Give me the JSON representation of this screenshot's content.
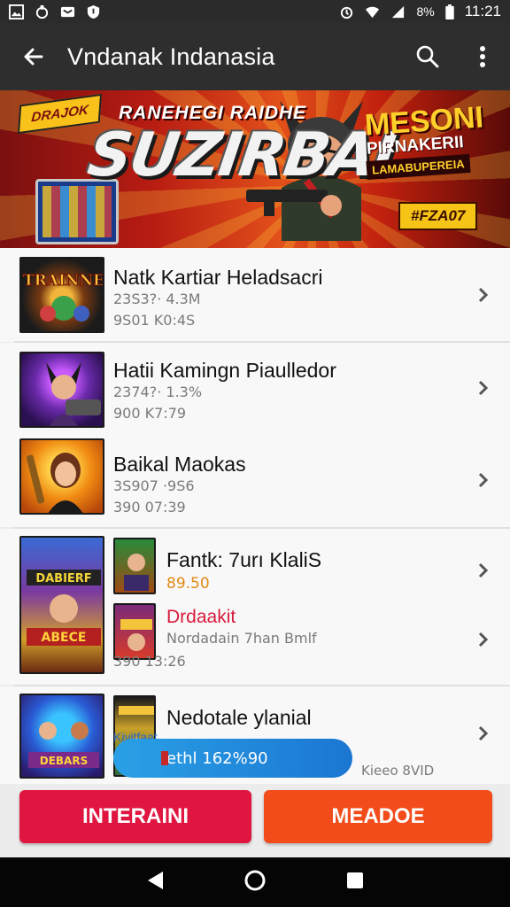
{
  "status_bar": {
    "time": "11:21",
    "battery": "8%",
    "icons": [
      "gallery-icon",
      "vpn-icon",
      "message-icon",
      "shield-icon",
      "alarm-icon",
      "wifi-icon",
      "signal-icon",
      "battery-icon"
    ]
  },
  "app_bar": {
    "title": "Vndanak Indanasia",
    "back_icon": "arrow-back-icon",
    "search_icon": "search-icon",
    "menu_icon": "more-vert-icon"
  },
  "banner": {
    "badge": "DRAJOK",
    "subtitle": "RANEHEGI RAIDHE",
    "headline": "SUZIRBAI",
    "right_line1": "MESONI",
    "right_line2": "PIRNAKERII",
    "right_line3": "LAMABUPEREIA",
    "code": "#FZA07"
  },
  "list": [
    {
      "title": "Natk Kartiar Heladsacri",
      "meta1": "23S3?· 4.3M",
      "meta2": "9S01 K0:4S"
    },
    {
      "title": "Hatii Kamingn Piaulledor",
      "meta1": "2374?· 1.3%",
      "meta2": "900 K7:79"
    },
    {
      "title": "Baikal Maokas",
      "meta1": "3S907 ·9S6",
      "meta2": "390 07:39"
    },
    {
      "title": "Fantk: 7urı KlaliS",
      "price": "89.50",
      "subtitle": "Drdaakit",
      "desc": "Nordadain 7han Bmlf",
      "meta2": "390 13:26"
    },
    {
      "title": "Nedotale ylanial",
      "pill_ghost": "Kivitfaat",
      "pill": "ethl 162%90",
      "note": "Kieeo 8VID"
    }
  ],
  "buttons": {
    "left": "INTERAINI",
    "right": "MEADOE"
  },
  "colors": {
    "appbar": "#2e2e2e",
    "primary_red": "#e01640",
    "primary_orange": "#f24c1a",
    "pill_blue": "#1b76d2",
    "price_orange": "#e28a14",
    "subtitle_red": "#d81b3c"
  },
  "nav_bar": {
    "back_icon": "triangle-back-icon",
    "home_icon": "circle-home-icon",
    "recents_icon": "square-recents-icon"
  }
}
